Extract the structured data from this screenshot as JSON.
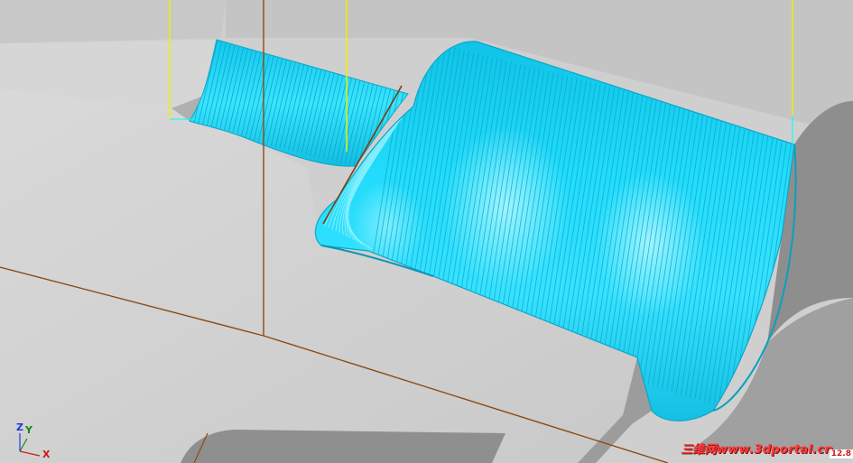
{
  "viewport": {
    "colors": {
      "background": "#a9a9a9",
      "stock_face": "#d0d0d0",
      "stock_face_light": "#dadada",
      "shadow": "#8a8a8a",
      "toolpath": "#14d4f4",
      "toolpath_light": "#8ff0ff",
      "toolpath_edge": "#0aa6c8",
      "boundary_line": "#8b4a12",
      "tool_line": "#f0f000"
    },
    "axis_triad": {
      "z_label": "Z",
      "y_label": "Y",
      "x_label": "X",
      "z_color": "#1d3cd6",
      "y_color": "#148c14",
      "x_color": "#d01818"
    },
    "watermark": {
      "text": "三维网www.3dportal.cn",
      "color": "#ff3a3a"
    },
    "corner_readout": {
      "text": "12.8",
      "color": "#d01818"
    }
  }
}
